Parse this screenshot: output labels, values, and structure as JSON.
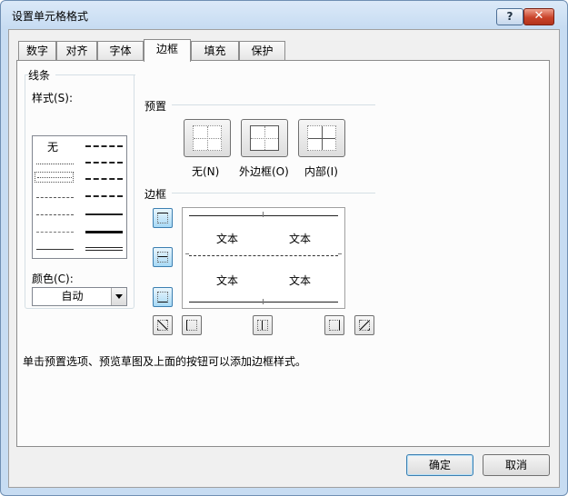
{
  "window": {
    "title": "设置单元格格式",
    "help_label": "?",
    "close_label": "✕"
  },
  "tabs": [
    {
      "label": "数字"
    },
    {
      "label": "对齐"
    },
    {
      "label": "字体"
    },
    {
      "label": "边框",
      "active": true
    },
    {
      "label": "填充"
    },
    {
      "label": "保护"
    }
  ],
  "line_group": {
    "title": "线条",
    "style_label": "样式(S):",
    "style_none": "无",
    "color_label": "颜色(C):",
    "color_value": "自动"
  },
  "presets": {
    "title": "预置",
    "none_label": "无(N)",
    "outline_label": "外边框(O)",
    "inside_label": "内部(I)"
  },
  "border": {
    "title": "边框",
    "preview_cells": [
      "文本",
      "文本",
      "文本",
      "文本"
    ]
  },
  "hint": "单击预置选项、预览草图及上面的按钮可以添加边框样式。",
  "footer": {
    "ok_label": "确定",
    "cancel_label": "取消"
  },
  "colors": {
    "accent": "#3c7fb1",
    "frame": "#c7dcf2",
    "close": "#c9432a"
  }
}
